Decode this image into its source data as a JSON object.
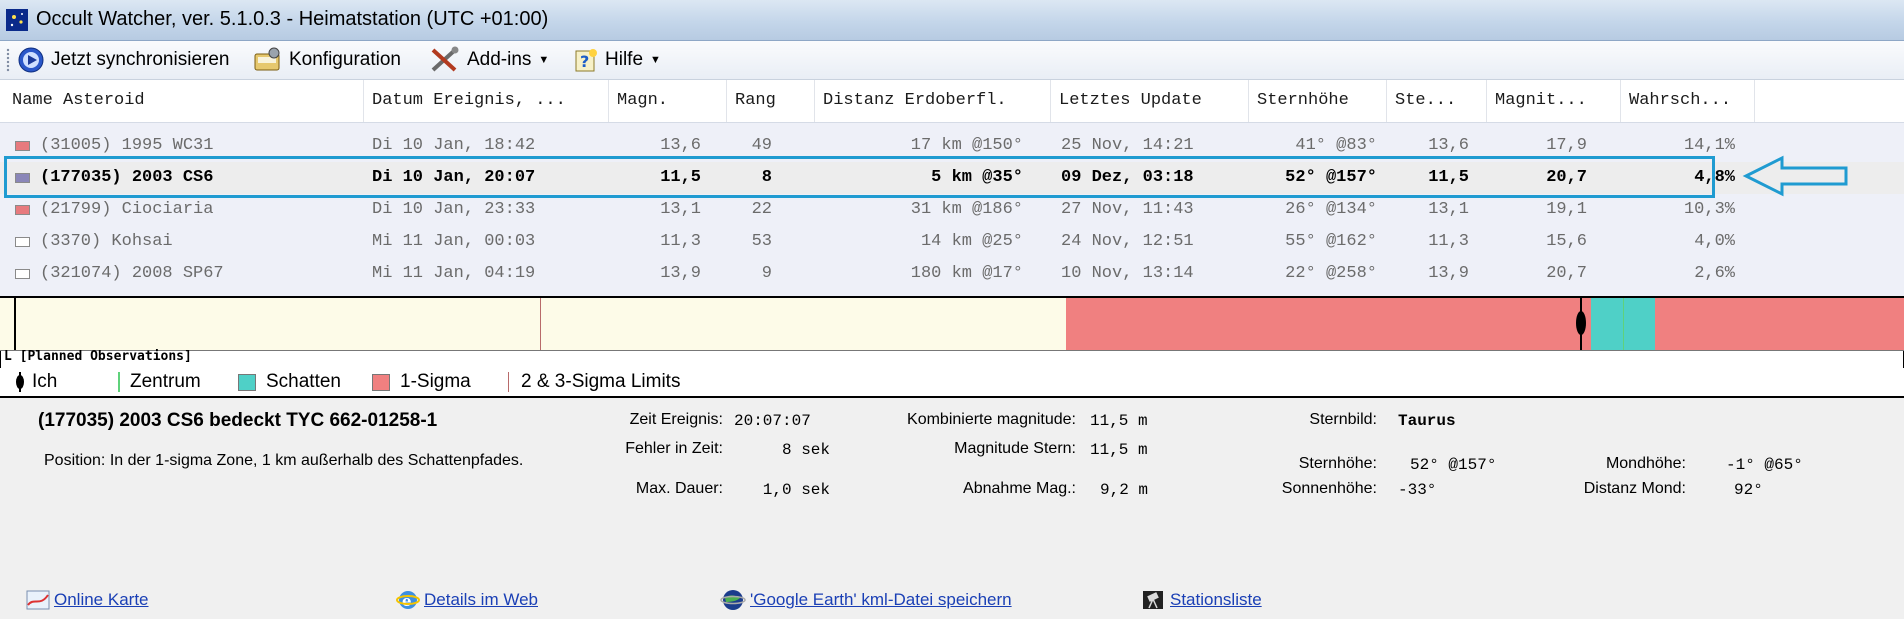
{
  "window": {
    "title": "Occult Watcher, ver. 5.1.0.3 - Heimatstation (UTC +01:00)"
  },
  "toolbar": {
    "sync_label": "Jetzt synchronisieren",
    "config_label": "Konfiguration",
    "addins_label": "Add-ins",
    "help_label": "Hilfe"
  },
  "table": {
    "columns": [
      "Name Asteroid",
      "Datum Ereignis, ...",
      "Magn.",
      "Rang",
      "Distanz Erdoberfl.",
      "Letztes Update",
      "Sternhöhe",
      "Ste...",
      "Magnit...",
      "Wahrsch..."
    ],
    "rows": [
      {
        "name": "(31005) 1995 WC31",
        "date": "Di 10 Jan, 18:42",
        "magn": "13,6",
        "rank": "49",
        "dist": "17 km @150°",
        "update": "25 Nov, 14:21",
        "alt": "41° @83°",
        "ste": "13,6",
        "magnit": "17,9",
        "prob": "14,1%",
        "swatch": "#e77a7e"
      },
      {
        "name": "(177035) 2003 CS6",
        "date": "Di 10 Jan, 20:07",
        "magn": "11,5",
        "rank": "8",
        "dist": "5 km @35°",
        "update": "09 Dez, 03:18",
        "alt": "52° @157°",
        "ste": "11,5",
        "magnit": "20,7",
        "prob": "4,8%",
        "swatch": "#8a86b8"
      },
      {
        "name": "(21799) Ciociaria",
        "date": "Di 10 Jan, 23:33",
        "magn": "13,1",
        "rank": "22",
        "dist": "31 km @186°",
        "update": "27 Nov, 11:43",
        "alt": "26° @134°",
        "ste": "13,1",
        "magnit": "19,1",
        "prob": "10,3%",
        "swatch": "#e77a7e"
      },
      {
        "name": "(3370) Kohsai",
        "date": "Mi 11 Jan, 00:03",
        "magn": "11,3",
        "rank": "53",
        "dist": "14 km @25°",
        "update": "24 Nov, 12:51",
        "alt": "55° @162°",
        "ste": "11,3",
        "magnit": "15,6",
        "prob": "4,0%",
        "swatch": "#ffffff"
      },
      {
        "name": "(321074) 2008 SP67",
        "date": "Mi 11 Jan, 04:19",
        "magn": "13,9",
        "rank": "9",
        "dist": "180 km @17°",
        "update": "10 Nov, 13:14",
        "alt": "22° @258°",
        "ste": "13,9",
        "magnit": "20,7",
        "prob": "2,6%",
        "swatch": "#ffffff"
      }
    ]
  },
  "strip": {
    "title": "L [Planned Observations]"
  },
  "legend": {
    "me": "Ich",
    "center": "Zentrum",
    "shadow": "Schatten",
    "sigma1": "1-Sigma",
    "sigma23": "2 & 3-Sigma Limits",
    "colors": {
      "shadow": "#4fd0c7",
      "sigma1": "#f08080",
      "center": "#5fd27b",
      "limits": "#b86a6a"
    }
  },
  "details": {
    "title": "(177035) 2003 CS6 bedeckt  TYC 662-01258-1",
    "position": "Position:  In der 1-sigma Zone, 1 km außerhalb des Schattenpfades.",
    "event_time_label": "Zeit Ereignis:",
    "event_time": "20:07:07",
    "time_error_label": "Fehler in Zeit:",
    "time_error": "8 sek",
    "max_duration_label": "Max. Dauer:",
    "max_duration": "1,0 sek",
    "combined_mag_label": "Kombinierte magnitude:",
    "combined_mag": "11,5 m",
    "star_mag_label": "Magnitude Stern:",
    "star_mag": "11,5 m",
    "mag_drop_label": "Abnahme Mag.:",
    "mag_drop": "9,2 m",
    "constellation_label": "Sternbild:",
    "constellation": "Taurus",
    "star_alt_label": "Sternhöhe:",
    "star_alt": "52° @157°",
    "sun_alt_label": "Sonnenhöhe:",
    "sun_alt": "-33°",
    "moon_alt_label": "Mondhöhe:",
    "moon_alt": "-1° @65°",
    "moon_dist_label": "Distanz Mond:",
    "moon_dist": "92°"
  },
  "links": {
    "map": "Online Karte",
    "web": "Details im Web",
    "kml": "'Google Earth' kml-Datei speichern",
    "stations": "Stationsliste"
  }
}
